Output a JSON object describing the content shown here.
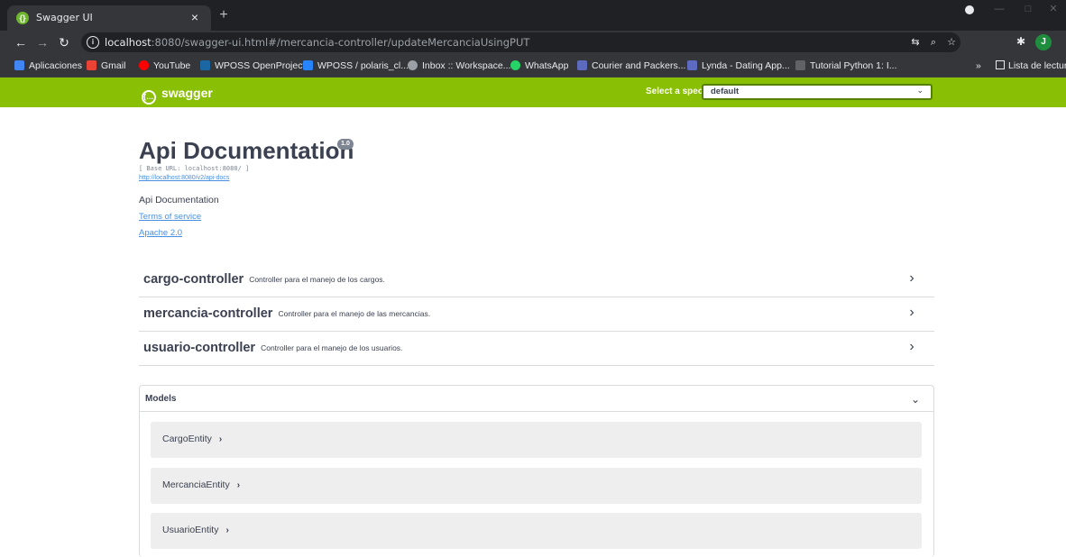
{
  "browser": {
    "tab_title": "Swagger UI",
    "url_host": "localhost",
    "url_rest": ":8080/swagger-ui.html#/mercancia-controller/updateMercanciaUsingPUT",
    "bookmarks": [
      {
        "label": "Aplicaciones",
        "color": "#4285f4"
      },
      {
        "label": "Gmail",
        "color": "#ea4335"
      },
      {
        "label": "YouTube",
        "color": "#ff0000"
      },
      {
        "label": "WPOSS OpenProject",
        "color": "#1a67a3"
      },
      {
        "label": "WPOSS / polaris_cl...",
        "color": "#2684ff"
      },
      {
        "label": "Inbox :: Workspace...",
        "color": "#9aa0a6"
      },
      {
        "label": "WhatsApp",
        "color": "#25d366"
      },
      {
        "label": "Courier and Packers...",
        "color": "#5c6bc0"
      },
      {
        "label": "Lynda - Dating App...",
        "color": "#5c6bc0"
      },
      {
        "label": "Tutorial Python 1: I...",
        "color": "#3c4043"
      }
    ],
    "more_bookmarks": "»",
    "reading_list": "Lista de lectura",
    "avatar_letter": "J"
  },
  "topbar": {
    "logo_text": "swagger",
    "spec_label": "Select a spec",
    "spec_value": "default"
  },
  "info": {
    "title": "Api Documentation",
    "version": "1.0",
    "base_url": "[ Base URL: localhost:8080/ ]",
    "api_docs_link": "http://localhost:8080/v2/api-docs",
    "description": "Api Documentation",
    "terms": "Terms of service",
    "license": "Apache 2.0"
  },
  "controllers": [
    {
      "name": "cargo-controller",
      "description": "Controller para el manejo de los cargos."
    },
    {
      "name": "mercancia-controller",
      "description": "Controller para el manejo de las mercancias."
    },
    {
      "name": "usuario-controller",
      "description": "Controller para el manejo de los usuarios."
    }
  ],
  "models": {
    "title": "Models",
    "items": [
      "CargoEntity",
      "MercanciaEntity",
      "UsuarioEntity"
    ]
  },
  "colors": {
    "swagger_green": "#89bf04",
    "text_dark": "#3b4151",
    "link_blue": "#4990e2"
  }
}
